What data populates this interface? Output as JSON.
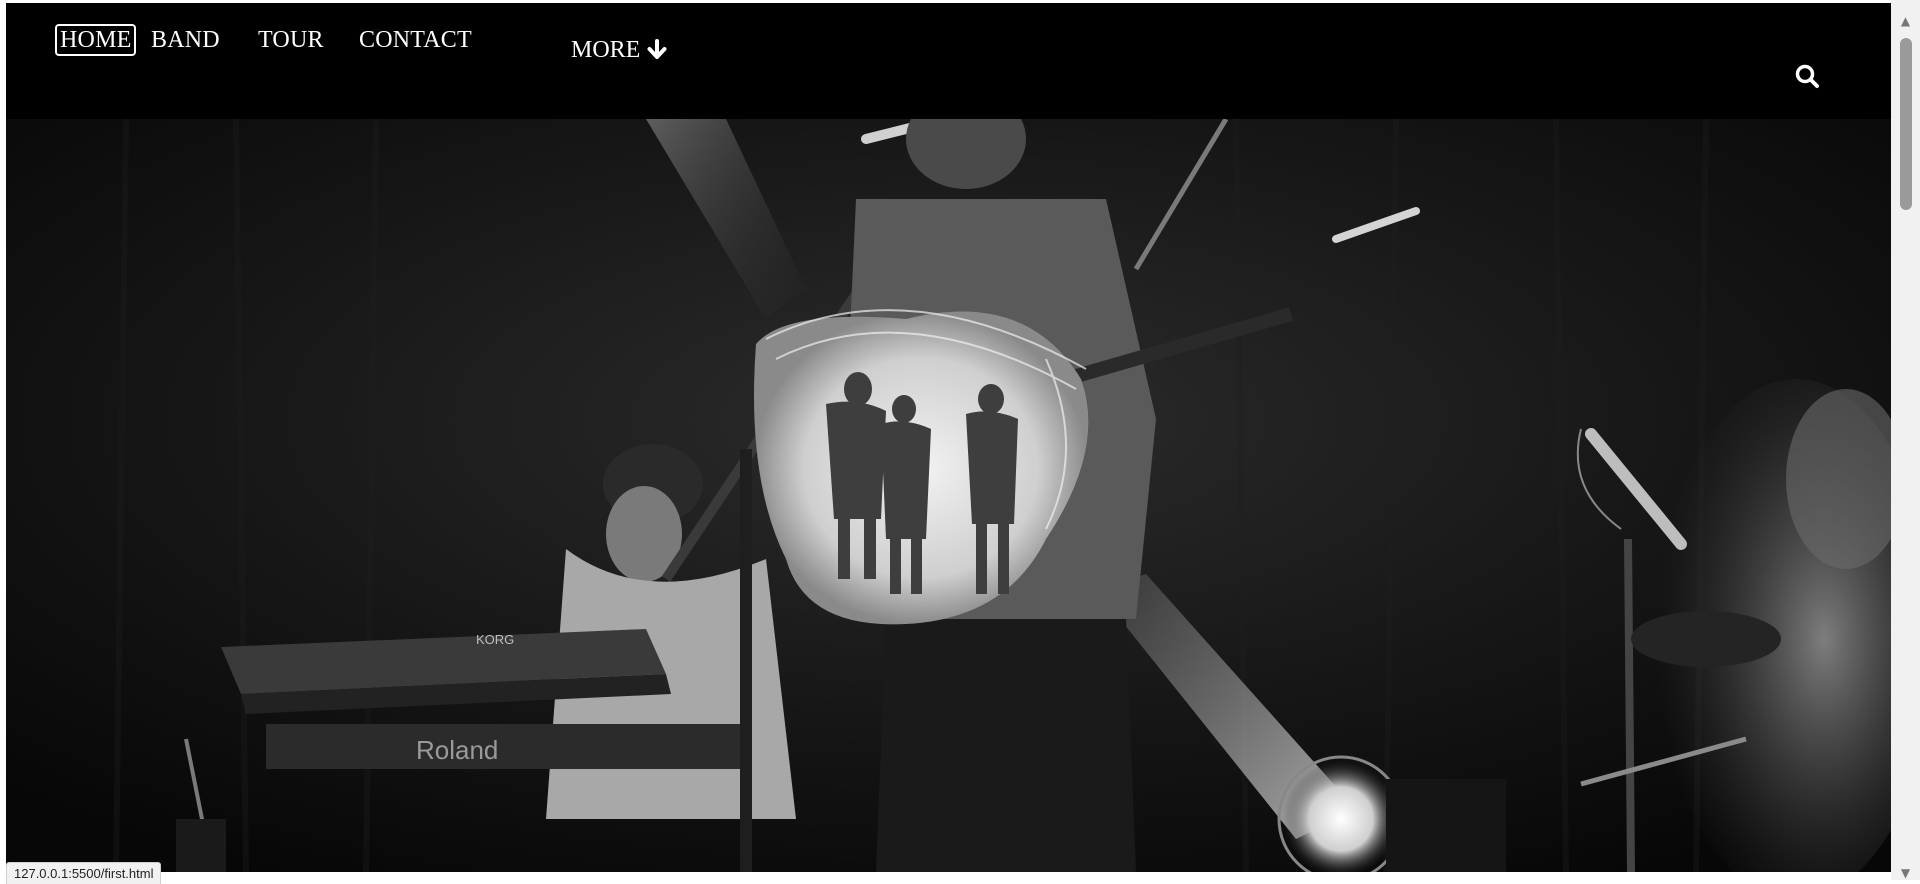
{
  "nav": {
    "items": [
      {
        "label": "HOME",
        "active": true
      },
      {
        "label": "BAND",
        "active": false
      },
      {
        "label": "TOUR",
        "active": false
      },
      {
        "label": "CONTACT",
        "active": false
      }
    ],
    "more_label": "MORE",
    "more_icon": "arrow-down-icon",
    "search_icon": "search-icon"
  },
  "hero": {
    "image": "band-on-stage-photo"
  },
  "browser": {
    "status_url": "127.0.0.1:5500/first.html"
  },
  "colors": {
    "nav_bg": "#000000",
    "nav_text": "#ffffff"
  }
}
